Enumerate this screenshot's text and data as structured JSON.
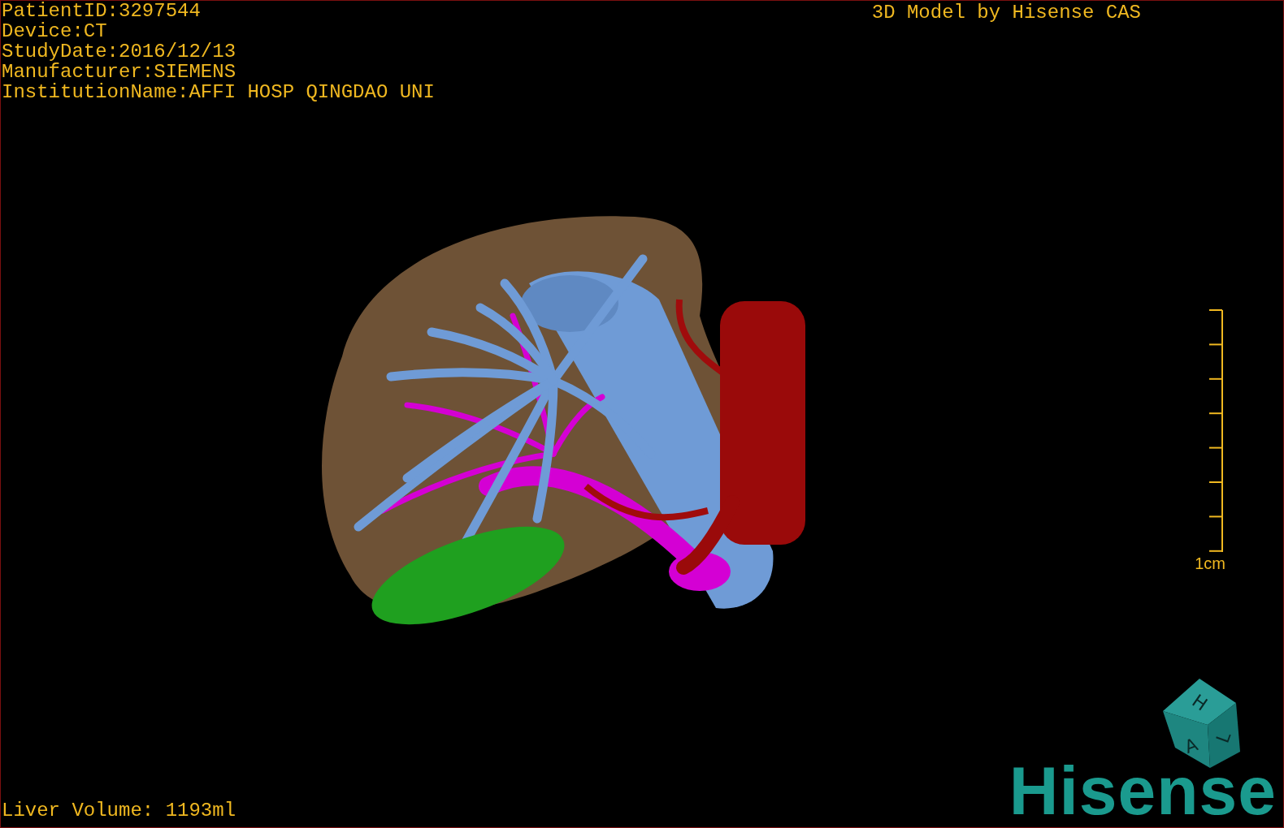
{
  "info_lines": [
    "PatientID:3297544",
    "Device:CT",
    "StudyDate:2016/12/13",
    "Manufacturer:SIEMENS",
    "InstitutionName:AFFI HOSP QINGDAO UNI"
  ],
  "title": "3D Model by Hisense CAS",
  "scale_bar": {
    "label": "1cm"
  },
  "orientation_cube": {
    "faces": [
      "H",
      "L",
      "A"
    ]
  },
  "liver_volume": "Liver Volume: 1193ml",
  "logo": "Hisense"
}
